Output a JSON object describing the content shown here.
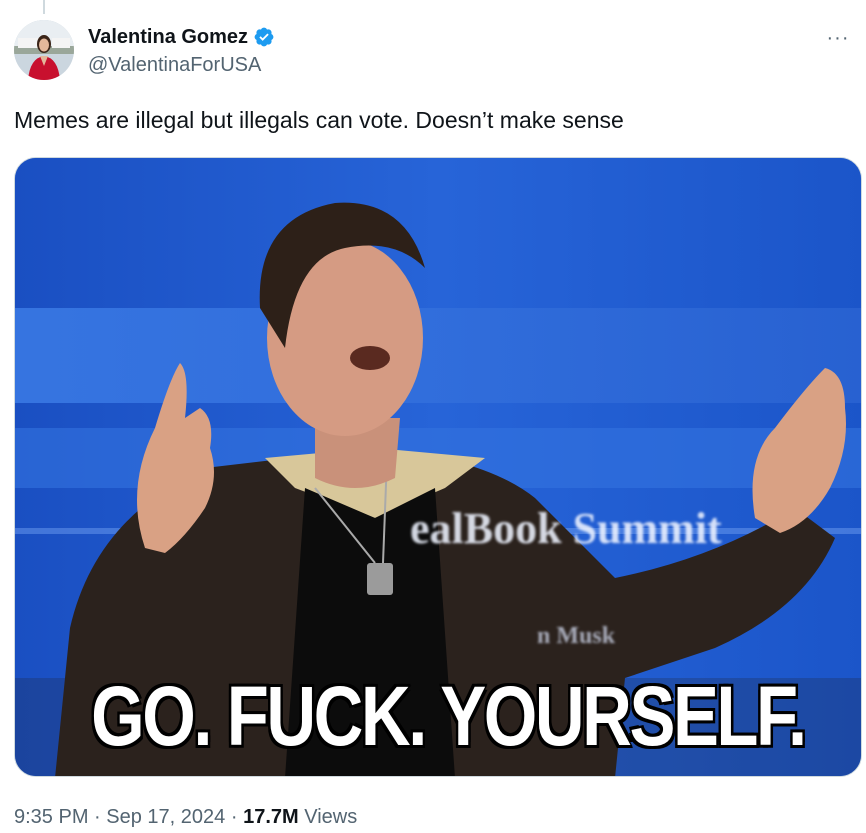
{
  "author": {
    "display_name": "Valentina Gomez",
    "handle": "@ValentinaForUSA",
    "verified_icon": "verified-badge-icon",
    "verified_color": "#1d9bf0"
  },
  "tweet": {
    "text": "Memes are illegal but illegals can vote. Doesn’t make sense",
    "more_icon": "more-options-icon",
    "more_label": "···"
  },
  "media": {
    "sign_text": "ealBook Summit",
    "sign_subtext": "n Musk",
    "caption": "GO. FUCK. YOURSELF."
  },
  "meta": {
    "time": "9:35 PM",
    "separator": "·",
    "date": "Sep 17, 2024",
    "views_count": "17.7M",
    "views_label": "Views"
  },
  "colors": {
    "text_primary": "#0f1419",
    "text_secondary": "#536471",
    "media_background": "#1d58c9"
  }
}
